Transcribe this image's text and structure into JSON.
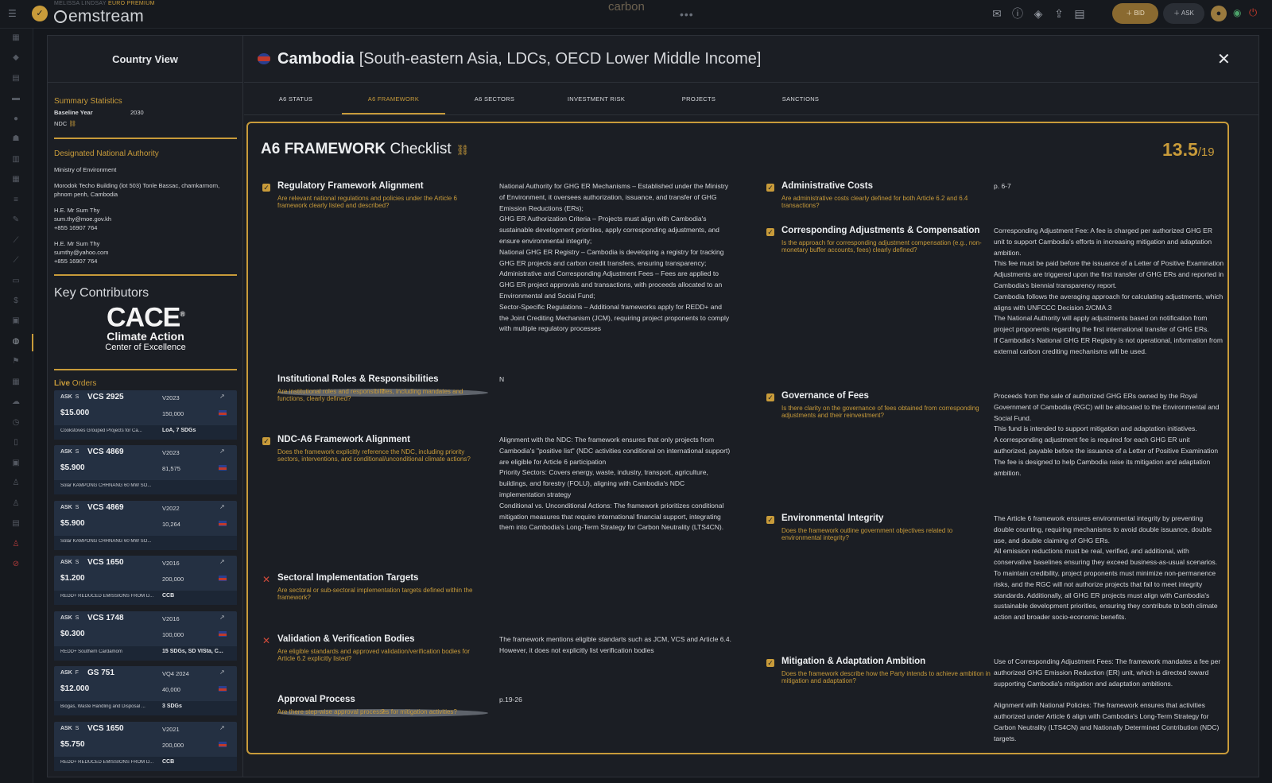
{
  "topbar": {
    "user": "MELISSA LINDSAY",
    "plan": "EURO PREMIUM",
    "brand": "emstream",
    "center_title": "carbon",
    "center_dots": "•••",
    "bid_label": "BID",
    "ask_label": "ASK"
  },
  "rail": {
    "icons": [
      "grid-icon",
      "tag-icon",
      "doc-icon",
      "folder-icon",
      "info-icon",
      "users-icon",
      "bank-icon",
      "table-icon",
      "list-icon",
      "wrench-icon",
      "chart-icon",
      "trend-icon",
      "briefcase-icon",
      "dollar-icon",
      "report-icon",
      "globe-icon",
      "flag-icon",
      "grid2-icon",
      "cloud-icon",
      "clock-icon",
      "file-icon",
      "printer-icon",
      "figure-icon",
      "runner-icon",
      "box-icon",
      "runner-red-icon",
      "alert-icon"
    ]
  },
  "left": {
    "title": "Country View",
    "summary": {
      "title": "Summary Statistics",
      "baseline_label": "Baseline Year",
      "baseline_value": "2030",
      "ndc_label": "NDC"
    },
    "dna": {
      "title": "Designated National Authority",
      "org": "Ministry of Environment",
      "address": "Morodok Techo Building (lot 503) Tonle Bassac, chamkarmorn, phnom penh, Cambodia",
      "contact1_name": "H.E. Mr Sum Thy",
      "contact1_email": "sum.thy@moe.gov.kh",
      "contact1_phone": "+855 16907 764",
      "contact2_name": "H.E. Mr Sum Thy",
      "contact2_email": "sumthy@yahoo.com",
      "contact2_phone": "+855 16907 764"
    },
    "contributors": {
      "title": "Key Contributors",
      "logo_big": "CACE",
      "logo_reg": "®",
      "logo_line1": "Climate Action",
      "logo_line2": "Center of Excellence"
    },
    "live": {
      "title_a": "Live",
      "title_b": " Orders"
    },
    "orders": [
      {
        "ask": "ASK",
        "side": "S",
        "code": "VCS 2925",
        "vintage": "V2023",
        "price": "$15.000",
        "qty": "150,000",
        "desc": "Cookstoves Grouped Projects for Ca...",
        "tag": "LoA, 7 SDGs"
      },
      {
        "ask": "ASK",
        "side": "S",
        "code": "VCS 4869",
        "vintage": "V2023",
        "price": "$5.900",
        "qty": "81,575",
        "desc": "Solar KAMPONG CHHNANG 60 MW SO...",
        "tag": ""
      },
      {
        "ask": "ASK",
        "side": "S",
        "code": "VCS 4869",
        "vintage": "V2022",
        "price": "$5.900",
        "qty": "10,264",
        "desc": "Solar KAMPONG CHHNANG 60 MW SO...",
        "tag": ""
      },
      {
        "ask": "ASK",
        "side": "S",
        "code": "VCS 1650",
        "vintage": "V2016",
        "price": "$1.200",
        "qty": "200,000",
        "desc": "REDD+ REDUCED EMISSIONS FROM D...",
        "tag": "CCB"
      },
      {
        "ask": "ASK",
        "side": "S",
        "code": "VCS 1748",
        "vintage": "V2016",
        "price": "$0.300",
        "qty": "100,000",
        "desc": "REDD+ Southern Cardamom",
        "tag": "15 SDGs, SD VISta, C..."
      },
      {
        "ask": "ASK",
        "side": "F",
        "code": "GS 751",
        "vintage": "VQ4 2024",
        "price": "$12.000",
        "qty": "40,000",
        "desc": "Biogas, Waste Handling and Disposal ...",
        "tag": "3 SDGs"
      },
      {
        "ask": "ASK",
        "side": "S",
        "code": "VCS 1650",
        "vintage": "V2021",
        "price": "$5.750",
        "qty": "200,000",
        "desc": "REDD+ REDUCED EMISSIONS FROM D...",
        "tag": "CCB"
      }
    ]
  },
  "header": {
    "country": "Cambodia",
    "meta": "[South-eastern Asia, LDCs, OECD Lower Middle Income]"
  },
  "tabs": [
    "A6 STATUS",
    "A6 FRAMEWORK",
    "A6 SECTORS",
    "INVESTMENT RISK",
    "PROJECTS",
    "SANCTIONS"
  ],
  "checklist": {
    "title_bold": "A6 FRAMEWORK",
    "title_rest": " Checklist",
    "score": "13.5",
    "score_total": "/19",
    "left_items": [
      {
        "status": "check",
        "title": "Regulatory Framework Alignment",
        "question": "Are relevant national regulations and policies under the Article 6 framework clearly listed and described?",
        "answer": "National Authority for GHG ER Mechanisms – Established under the Ministry of Environment, it oversees authorization, issuance, and transfer of GHG Emission Reductions (ERs);\nGHG ER Authorization Criteria – Projects must align with Cambodia's sustainable development priorities, apply corresponding adjustments, and ensure environmental integrity;\nNational GHG ER Registry – Cambodia is developing a registry for tracking GHG ER projects and carbon credit transfers, ensuring transparency;\nAdministrative and Corresponding Adjustment Fees – Fees are applied to GHG ER project approvals and transactions, with proceeds allocated to an Environmental and Social Fund;\nSector-Specific Regulations – Additional frameworks apply for REDD+ and the Joint Crediting Mechanism (JCM), requiring project proponents to comply with multiple regulatory processes"
      },
      {
        "status": "partial",
        "title": "Institutional Roles & Responsibilities",
        "question": "Are institutional roles and responsibilities, including mandates and functions, clearly defined?",
        "answer": "N"
      },
      {
        "status": "check",
        "title": "NDC-A6 Framework Alignment",
        "question": "Does the framework explicitly reference the NDC, including priority sectors, interventions, and conditional/unconditional climate actions?",
        "answer": "Alignment with the NDC: The framework ensures that only projects from Cambodia's \"positive list\" (NDC activities conditional on international support) are eligible for Article 6 participation\nPriority Sectors: Covers energy, waste, industry, transport, agriculture, buildings, and forestry (FOLU), aligning with Cambodia's NDC implementation strategy\nConditional vs. Unconditional Actions: The framework prioritizes conditional mitigation measures that require international financial support, integrating them into Cambodia's Long-Term Strategy for Carbon Neutrality (LTS4CN)."
      },
      {
        "status": "cross",
        "title": "Sectoral Implementation Targets",
        "question": "Are sectoral or sub-sectoral implementation targets defined within the framework?",
        "answer": ""
      },
      {
        "status": "cross",
        "title": "Validation & Verification Bodies",
        "question": "Are eligible standards and approved validation/verification bodies for Article 6.2 explicitly listed?",
        "answer": "The framework mentions eligible standarts such as JCM, VCS and Article 6.4. However, it does not explicitly list verification bodies"
      },
      {
        "status": "partial",
        "title": "Approval Process",
        "question": "Are there step-wise approval processes for mitigation activities?",
        "answer": "p.19-26"
      }
    ],
    "right_items": [
      {
        "status": "check",
        "title": "Administrative Costs",
        "question": "Are administrative costs clearly defined for both Article 6.2 and 6.4 transactions?",
        "answer": "p. 6-7"
      },
      {
        "status": "check",
        "title": "Corresponding Adjustments & Compensation",
        "question": "Is the approach for corresponding adjustment compensation (e.g., non-monetary buffer accounts, fees) clearly defined?",
        "answer": "Corresponding Adjustment Fee: A fee is charged per authorized GHG ER unit to support Cambodia's efforts in increasing mitigation and adaptation ambition.\nThis fee must be paid before the issuance of a Letter of Positive Examination Adjustments are triggered upon the first transfer of GHG ERs and reported in Cambodia's biennial transparency report.\nCambodia follows the averaging approach for calculating adjustments, which aligns with UNFCCC Decision 2/CMA.3\nThe National Authority will apply adjustments based on notification from project proponents regarding the first international transfer of GHG ERs.\nIf Cambodia's National GHG ER Registry is not operational, information from external carbon crediting mechanisms will be used."
      },
      {
        "status": "check",
        "title": "Governance of Fees",
        "question": "Is there clarity on the governance of fees obtained from corresponding adjustments and their reinvestment?",
        "answer": "Proceeds from the sale of authorized GHG ERs owned by the Royal Government of Cambodia (RGC) will be allocated to the Environmental and Social Fund.\nThis fund is intended to support mitigation and adaptation initiatives.\nA corresponding adjustment fee is required for each GHG ER unit authorized, payable before the issuance of a Letter of Positive Examination\nThe fee is designed to help Cambodia raise its mitigation and adaptation ambition."
      },
      {
        "status": "check",
        "title": "Environmental Integrity",
        "question": "Does the framework outline government objectives related to environmental integrity?",
        "answer": "The Article 6 framework ensures environmental integrity by preventing double counting, requiring mechanisms to avoid double issuance, double use, and double claiming of GHG ERs.\nAll emission reductions must be real, verified, and additional, with conservative baselines ensuring they exceed business-as-usual scenarios.\nTo maintain credibility, project proponents must minimize non-permanence risks, and the RGC will not authorize projects that fail to meet integrity standards. Additionally, all GHG ER projects must align with Cambodia's sustainable development priorities, ensuring they contribute to both climate action and broader socio-economic benefits."
      },
      {
        "status": "check",
        "title": "Mitigation & Adaptation Ambition",
        "question": "Does the framework describe how the Party intends to achieve ambition in mitigation and adaptation?",
        "answer": "Use of Corresponding Adjustment Fees: The framework mandates a fee per authorized GHG Emission Reduction (ER) unit, which is directed toward supporting Cambodia's mitigation and adaptation ambitions.\n\nAlignment with National Policies: The framework ensures that activities authorized under Article 6 align with Cambodia's Long-Term Strategy for Carbon Neutrality (LTS4CN) and Nationally Determined Contribution (NDC) targets."
      }
    ]
  }
}
